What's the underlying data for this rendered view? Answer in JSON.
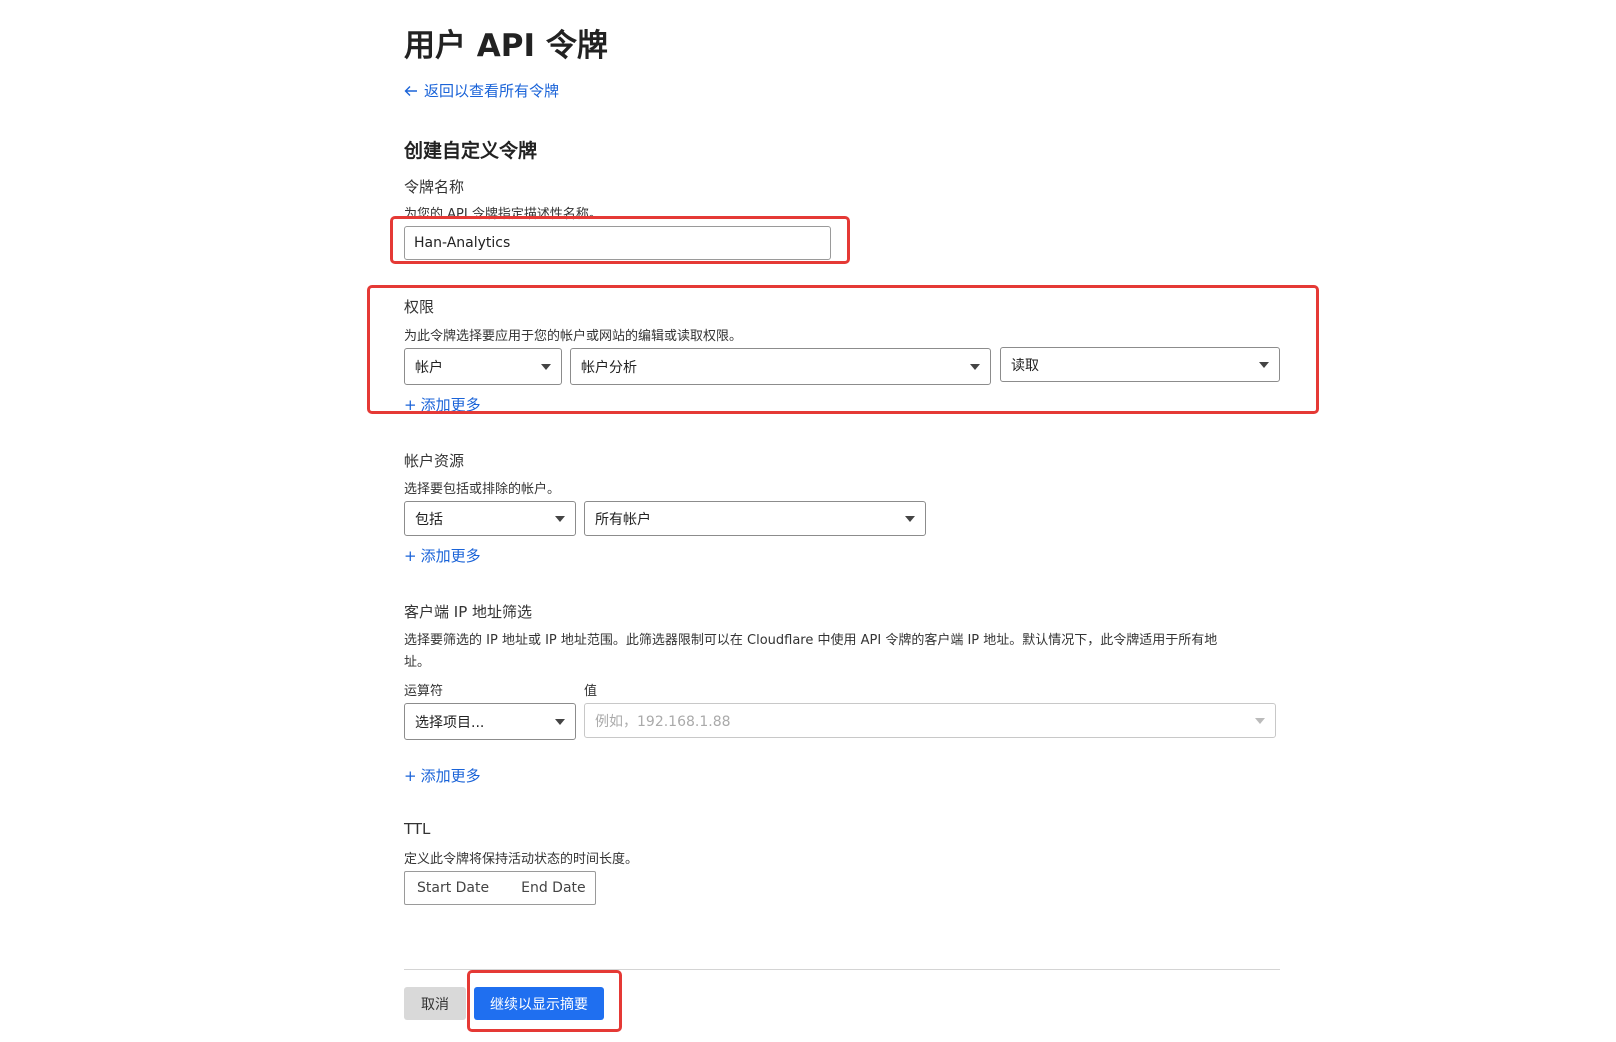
{
  "page": {
    "title": "用户 API 令牌",
    "back_link": "返回以查看所有令牌",
    "section_title": "创建自定义令牌"
  },
  "token_name": {
    "label": "令牌名称",
    "help": "为您的 API 令牌指定描述性名称。",
    "value": "Han-Analytics"
  },
  "permissions": {
    "label": "权限",
    "help": "为此令牌选择要应用于您的帐户或网站的编辑或读取权限。",
    "scope": "帐户",
    "resource": "帐户分析",
    "access": "读取",
    "add_more": "添加更多"
  },
  "account_resources": {
    "label": "帐户资源",
    "help": "选择要包括或排除的帐户。",
    "mode": "包括",
    "target": "所有帐户",
    "add_more": "添加更多"
  },
  "ip_filter": {
    "label": "客户端 IP 地址筛选",
    "help_line1": "选择要筛选的 IP 地址或 IP 地址范围。此筛选器限制可以在 Cloudflare 中使用 API 令牌的客户端 IP 地址。默认情况下，此令牌适用于所有地",
    "help_line2": "址。",
    "operator_label": "运算符",
    "value_label": "值",
    "operator_placeholder": "选择项目...",
    "value_placeholder": "例如，192.168.1.88",
    "add_more": "添加更多"
  },
  "ttl": {
    "label": "TTL",
    "help": "定义此令牌将保持活动状态的时间长度。",
    "start_placeholder": "Start Date",
    "end_placeholder": "End Date"
  },
  "actions": {
    "cancel": "取消",
    "continue": "继续以显示摘要"
  },
  "colors": {
    "link": "#1a63d8",
    "primary_button": "#1f6ff0",
    "highlight": "#e53935"
  }
}
